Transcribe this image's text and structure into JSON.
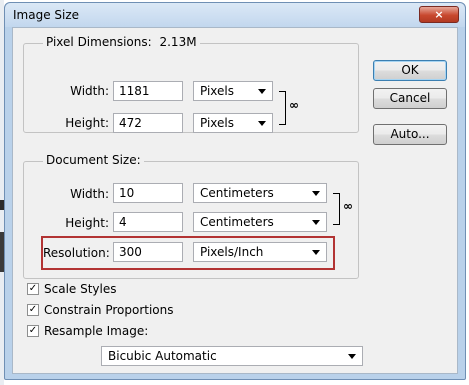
{
  "dialog": {
    "title": "Image Size",
    "close_glyph": "×"
  },
  "pixel_dimensions": {
    "label": "Pixel Dimensions:",
    "size": "2.13M",
    "width_label": "Width:",
    "width_value": "1181",
    "width_unit": "Pixels",
    "height_label": "Height:",
    "height_value": "472",
    "height_unit": "Pixels",
    "link_icon": "chain-link"
  },
  "document_size": {
    "label": "Document Size:",
    "width_label": "Width:",
    "width_value": "10",
    "width_unit": "Centimeters",
    "height_label": "Height:",
    "height_value": "4",
    "height_unit": "Centimeters",
    "resolution_label": "Resolution:",
    "resolution_value": "300",
    "resolution_unit": "Pixels/Inch",
    "link_icon": "chain-link",
    "highlight_color": "#b23333"
  },
  "options": {
    "scale_styles": {
      "label": "Scale Styles",
      "checked": true
    },
    "constrain_proportions": {
      "label": "Constrain Proportions",
      "checked": true
    },
    "resample_image": {
      "label": "Resample Image:",
      "checked": true
    },
    "resample_method": "Bicubic Automatic",
    "check_glyph": "✓"
  },
  "buttons": {
    "ok": "OK",
    "cancel": "Cancel",
    "auto": "Auto..."
  }
}
